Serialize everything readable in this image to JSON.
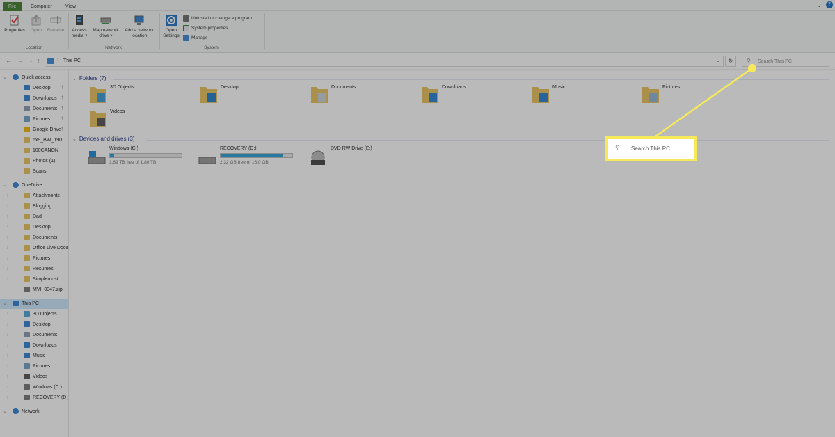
{
  "ribbon": {
    "tabs": [
      "File",
      "Computer",
      "View"
    ],
    "groups": {
      "location": {
        "label": "Location",
        "buttons": [
          "Properties",
          "Open",
          "Rename"
        ]
      },
      "network": {
        "label": "Network",
        "buttons": [
          "Access media ▾",
          "Map network drive ▾",
          "Add a network location"
        ]
      },
      "system": {
        "label": "System",
        "open_settings": "Open Settings",
        "small": [
          "Uninstall or change a program",
          "System properties",
          "Manage"
        ]
      }
    }
  },
  "address": {
    "path": "This PC",
    "search_placeholder": "Search This PC"
  },
  "sidebar": {
    "items": [
      {
        "label": "Quick access",
        "icon": "star-icon",
        "pinned": false
      },
      {
        "label": "Desktop",
        "icon": "desktop-icon",
        "pinned": true
      },
      {
        "label": "Downloads",
        "icon": "download-icon",
        "pinned": true
      },
      {
        "label": "Documents",
        "icon": "documents-icon",
        "pinned": true
      },
      {
        "label": "Pictures",
        "icon": "pictures-icon",
        "pinned": true
      },
      {
        "label": "Google Drive",
        "icon": "google-drive-icon",
        "pinned": true
      },
      {
        "label": "6x9_BW_190",
        "icon": "folder-icon",
        "pinned": false
      },
      {
        "label": "100CANON",
        "icon": "folder-icon",
        "pinned": false
      },
      {
        "label": "Photos (1)",
        "icon": "folder-icon",
        "pinned": false
      },
      {
        "label": "Scans",
        "icon": "folder-icon",
        "pinned": false
      },
      {
        "label": "OneDrive",
        "icon": "cloud-icon",
        "pinned": false
      },
      {
        "label": "Attachments",
        "icon": "folder-icon",
        "pinned": false
      },
      {
        "label": "Blogging",
        "icon": "folder-icon",
        "pinned": false
      },
      {
        "label": "Dad",
        "icon": "folder-icon",
        "pinned": false
      },
      {
        "label": "Desktop",
        "icon": "folder-icon",
        "pinned": false
      },
      {
        "label": "Documents",
        "icon": "folder-icon",
        "pinned": false
      },
      {
        "label": "Office Live Docume",
        "icon": "folder-icon",
        "pinned": false
      },
      {
        "label": "Pictures",
        "icon": "folder-icon",
        "pinned": false
      },
      {
        "label": "Resumes",
        "icon": "folder-icon",
        "pinned": false
      },
      {
        "label": "Simplemost",
        "icon": "folder-icon",
        "pinned": false
      },
      {
        "label": "MVI_0347.zip",
        "icon": "zip-icon",
        "pinned": false
      },
      {
        "label": "This PC",
        "icon": "computer-icon",
        "pinned": false,
        "selected": true
      },
      {
        "label": "3D Objects",
        "icon": "3d-objects-icon",
        "pinned": false
      },
      {
        "label": "Desktop",
        "icon": "desktop-icon",
        "pinned": false
      },
      {
        "label": "Documents",
        "icon": "documents-icon",
        "pinned": false
      },
      {
        "label": "Downloads",
        "icon": "download-icon",
        "pinned": false
      },
      {
        "label": "Music",
        "icon": "music-icon",
        "pinned": false
      },
      {
        "label": "Pictures",
        "icon": "pictures-icon",
        "pinned": false
      },
      {
        "label": "Videos",
        "icon": "videos-icon",
        "pinned": false
      },
      {
        "label": "Windows (C:)",
        "icon": "drive-icon",
        "pinned": false
      },
      {
        "label": "RECOVERY (D:)",
        "icon": "drive-icon",
        "pinned": false
      },
      {
        "label": "Network",
        "icon": "network-icon",
        "pinned": false
      }
    ]
  },
  "folders": {
    "header": "Folders (7)",
    "items": [
      "3D Objects",
      "Desktop",
      "Documents",
      "Downloads",
      "Music",
      "Pictures",
      "Videos"
    ]
  },
  "drives": {
    "header": "Devices and drives (3)",
    "items": [
      {
        "label": "Windows (C:)",
        "info": "1.69 TB free of 1.80 TB",
        "used_fraction": 0.06
      },
      {
        "label": "RECOVERY (D:)",
        "info": "2.32 GB free of 16.0 GB",
        "used_fraction": 0.86
      },
      {
        "label": "DVD RW Drive (E:)",
        "info": "",
        "used_fraction": null
      }
    ]
  },
  "callout": {
    "text": "Search This PC",
    "color": "#f6ea5b"
  },
  "colors": {
    "file_tab": "#3e7b2c",
    "selection": "#cce8ff",
    "drive_bar": "#26a0da",
    "folder": "#e8c15a",
    "section_header": "#1e3287"
  }
}
